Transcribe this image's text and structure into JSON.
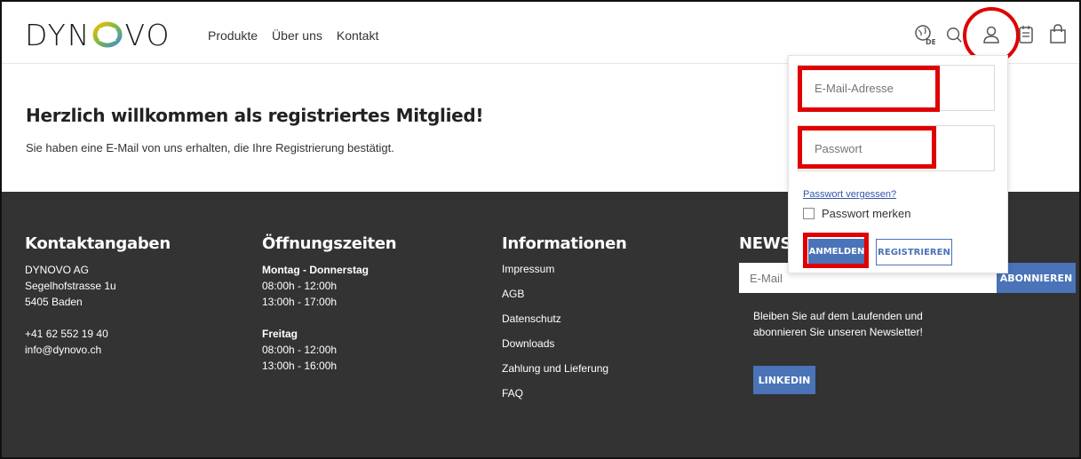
{
  "header": {
    "logo_left": "DYN",
    "logo_right": "VO",
    "nav": [
      "Produkte",
      "Über uns",
      "Kontakt"
    ],
    "icons": [
      "language-icon",
      "search-icon",
      "user-icon",
      "notes-icon",
      "shopping-bag-icon"
    ],
    "language_code": "DE"
  },
  "main": {
    "title": "Herzlich willkommen als registriertes Mitglied!",
    "text": "Sie haben eine E-Mail von uns erhalten, die Ihre Registrierung bestätigt."
  },
  "footer": {
    "contact": {
      "heading": "Kontaktangaben",
      "lines": [
        "DYNOVO AG",
        "Segelhofstrasse 1u",
        "5405 Baden",
        "",
        "+41 62 552 19 40",
        "info@dynovo.ch"
      ]
    },
    "hours": {
      "heading": "Öffnungszeiten",
      "block1_title": "Montag - Donnerstag",
      "block1_lines": [
        "08:00h - 12:00h",
        "13:00h - 17:00h"
      ],
      "block2_title": "Freitag",
      "block2_lines": [
        "08:00h - 12:00h",
        "13:00h - 16:00h"
      ]
    },
    "info": {
      "heading": "Informationen",
      "links": [
        "Impressum",
        "AGB",
        "Datenschutz",
        "Downloads",
        "Zahlung und Lieferung",
        "FAQ"
      ]
    },
    "newsletter": {
      "heading": "NEWSL",
      "placeholder": "E-Mail",
      "button": "ABONNIEREN",
      "text": "Bleiben Sie auf dem Laufenden und abonnieren Sie unseren Newsletter!",
      "linkedin": "LINKEDIN"
    }
  },
  "login": {
    "email_placeholder": "E-Mail-Adresse",
    "password_placeholder": "Passwort",
    "forgot": "Passwort vergessen?",
    "remember": "Passwort merken",
    "login_button": "ANMELDEN",
    "register_button": "REGISTRIEREN"
  },
  "colors": {
    "accent": "#4a73b8",
    "footer_bg": "#333333",
    "highlight": "#e00000"
  }
}
